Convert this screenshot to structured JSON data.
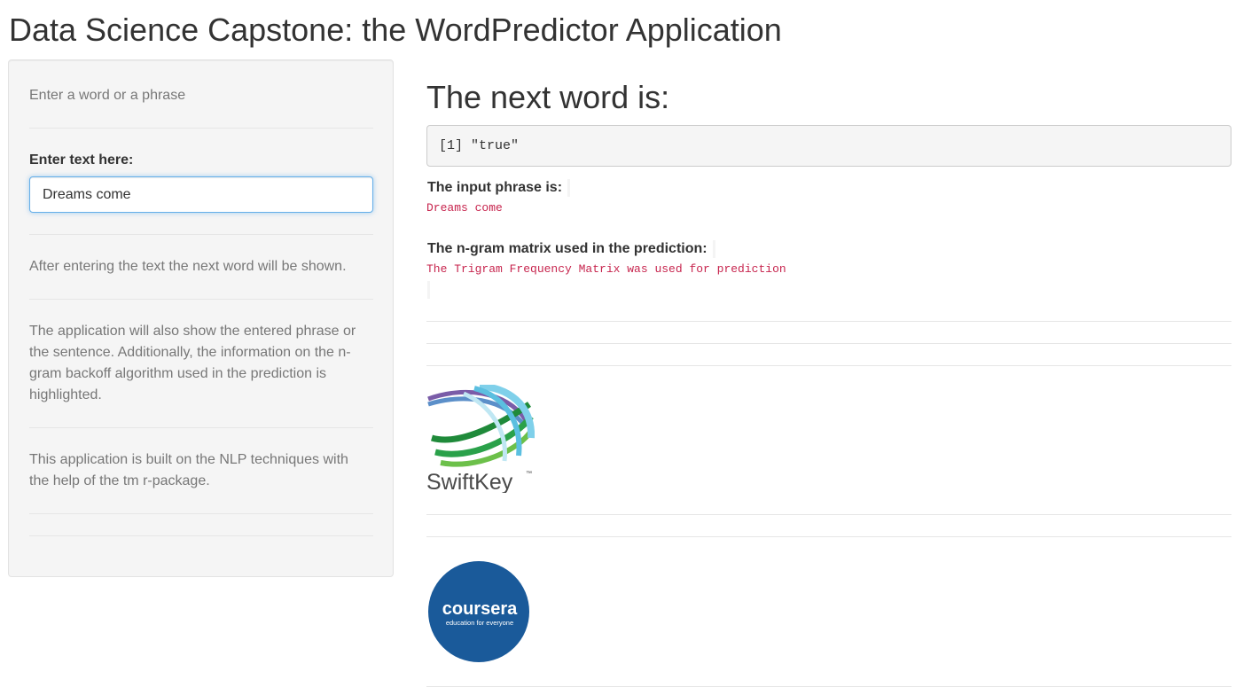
{
  "header": {
    "title": "Data Science Capstone: the WordPredictor Application"
  },
  "sidebar": {
    "intro": "Enter a word or a phrase",
    "input_label": "Enter text here:",
    "input_value": "Dreams come",
    "help_1": "After entering the text the next word will be shown.",
    "help_2": "The application will also show the entered phrase or the sentence. Additionally, the information on the n-gram backoff algorithm used in the prediction is highlighted.",
    "help_3": "This application is built on the NLP techniques with the help of the tm r-package."
  },
  "main": {
    "heading": "The next word is:",
    "prediction_output": "[1] \"true\"",
    "input_phrase_label": "The input phrase is:",
    "input_phrase_value": "Dreams come",
    "ngram_label": "The n-gram matrix used in the prediction:",
    "ngram_value": "The Trigram Frequency Matrix was used for prediction"
  },
  "logos": {
    "swiftkey": {
      "text": "SwiftKey",
      "trademark": "™"
    },
    "coursera": {
      "text": "coursera",
      "tagline": "education for everyone",
      "color": "#1a5a9a"
    }
  },
  "colors": {
    "code_text": "#c7254e",
    "input_focus": "#66afe9",
    "sidebar_bg": "#f5f5f5"
  }
}
